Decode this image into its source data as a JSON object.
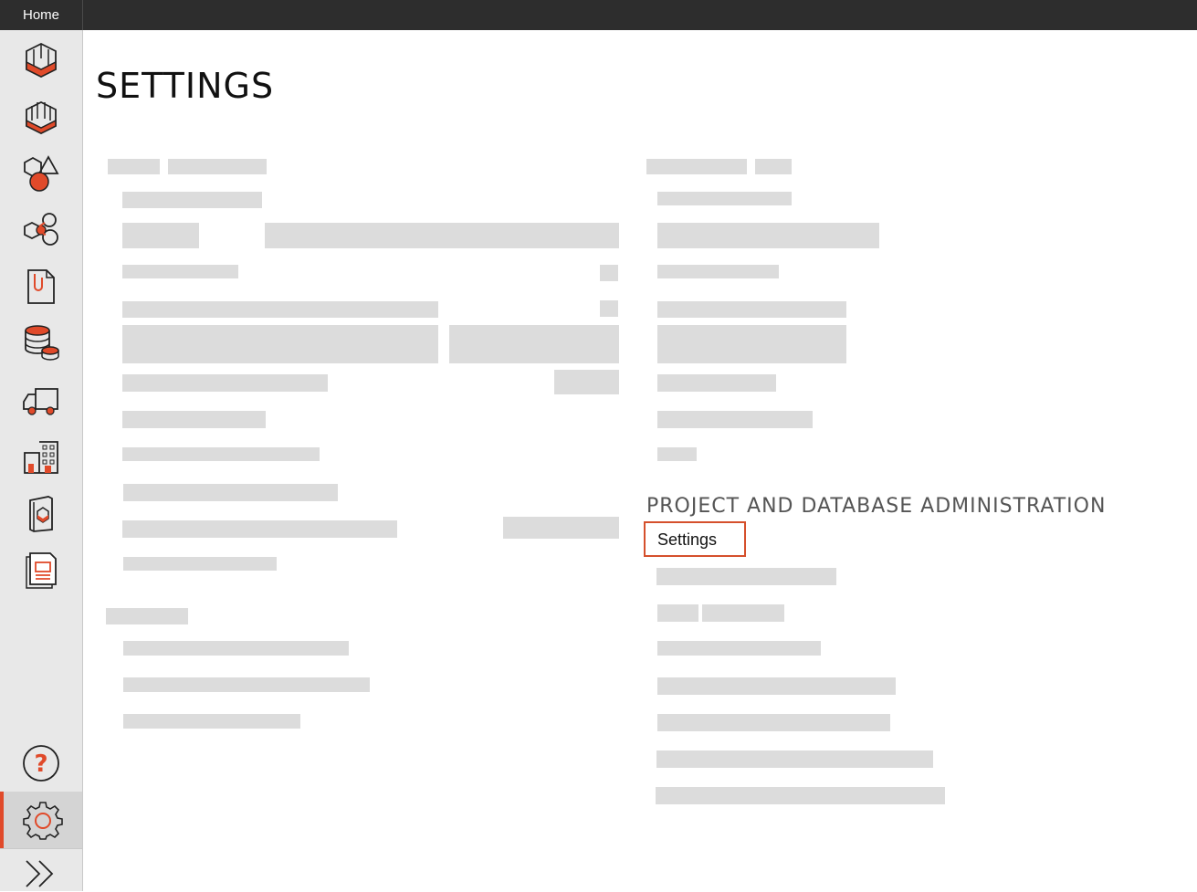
{
  "topbar": {
    "home_label": "Home"
  },
  "sidebar": {
    "items": [
      {
        "icon": "single-model-icon"
      },
      {
        "icon": "multi-model-icon"
      },
      {
        "icon": "objects-icon"
      },
      {
        "icon": "relations-icon"
      },
      {
        "icon": "documents-icon"
      },
      {
        "icon": "database-icon"
      },
      {
        "icon": "delivery-truck-icon"
      },
      {
        "icon": "buildings-icon"
      },
      {
        "icon": "catalog-icon"
      },
      {
        "icon": "reports-icon"
      }
    ],
    "help_icon": "help-icon",
    "settings_icon": "settings-gear-icon",
    "expand_icon": "expand-chevrons-icon"
  },
  "main": {
    "title": "SETTINGS",
    "admin_section": {
      "heading": "PROJECT AND DATABASE ADMINISTRATION",
      "settings_link": "Settings"
    }
  },
  "colors": {
    "accent": "#e04a2a",
    "topbar": "#2d2d2d",
    "sidebar": "#e8e8e8",
    "placeholder": "#dcdcdc"
  }
}
